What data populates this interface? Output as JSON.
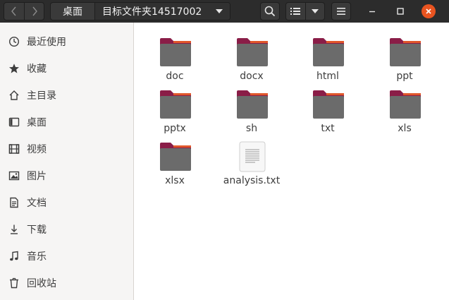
{
  "header": {
    "back_icon": "chevron-left-icon",
    "forward_icon": "chevron-right-icon",
    "breadcrumb": {
      "desktop": "桌面",
      "current": "目标文件夹14517002"
    },
    "tools": [
      "search-icon",
      "list-view-icon",
      "view-options-icon",
      "hamburger-menu-icon"
    ],
    "window_controls": [
      "minimize-icon",
      "maximize-icon",
      "close-icon"
    ],
    "colors": {
      "headerbar": "#2c2c2c",
      "close": "#e95420"
    }
  },
  "sidebar": {
    "items": [
      {
        "label": "最近使用",
        "icon": "recent-clock-icon"
      },
      {
        "label": "收藏",
        "icon": "star-icon"
      },
      {
        "label": "主目录",
        "icon": "home-icon"
      },
      {
        "label": "桌面",
        "icon": "desktop-icon"
      },
      {
        "label": "视频",
        "icon": "video-icon"
      },
      {
        "label": "图片",
        "icon": "image-icon"
      },
      {
        "label": "文档",
        "icon": "document-icon"
      },
      {
        "label": "下载",
        "icon": "download-icon"
      },
      {
        "label": "音乐",
        "icon": "music-icon"
      },
      {
        "label": "回收站",
        "icon": "trash-icon"
      }
    ]
  },
  "files": [
    {
      "name": "doc",
      "kind": "folder"
    },
    {
      "name": "docx",
      "kind": "folder"
    },
    {
      "name": "html",
      "kind": "folder"
    },
    {
      "name": "ppt",
      "kind": "folder"
    },
    {
      "name": "pptx",
      "kind": "folder"
    },
    {
      "name": "sh",
      "kind": "folder"
    },
    {
      "name": "txt",
      "kind": "folder"
    },
    {
      "name": "xls",
      "kind": "folder"
    },
    {
      "name": "xlsx",
      "kind": "folder"
    },
    {
      "name": "analysis.txt",
      "kind": "text-file"
    }
  ],
  "colors": {
    "folder_body": "#6b6b6b",
    "folder_tab": "#8a1d47",
    "folder_tab_accent": "#e0572b"
  }
}
